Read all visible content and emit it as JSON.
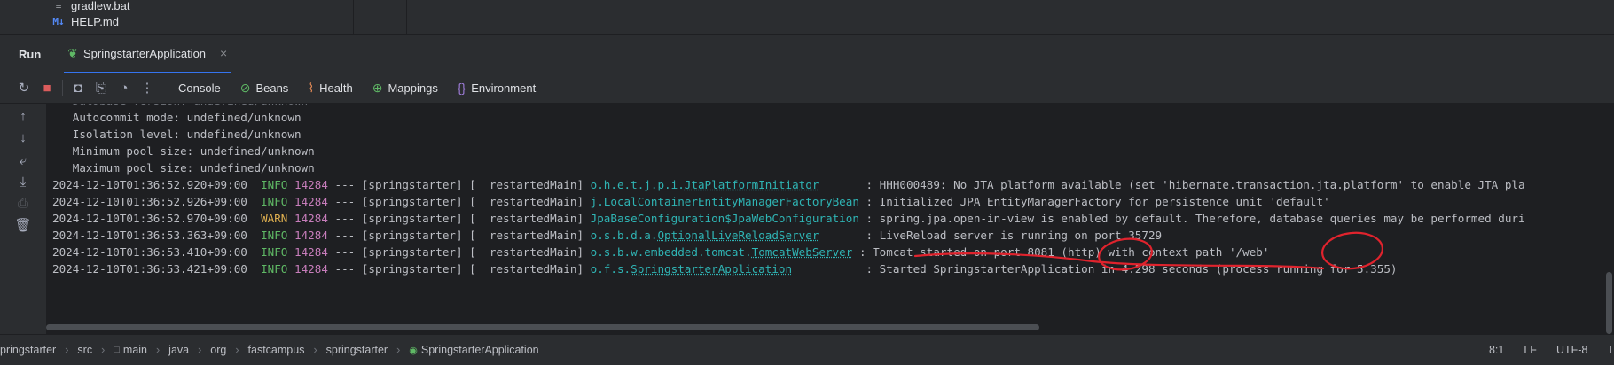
{
  "project_tree": {
    "items": [
      {
        "label": "gradlew.bat",
        "icon": "file-lines-icon"
      },
      {
        "label": "HELP.md",
        "icon": "markdown-icon"
      }
    ]
  },
  "run_window": {
    "title": "Run",
    "tab_label": "SpringstarterApplication"
  },
  "toolbar": {
    "tabs": [
      {
        "label": "Console",
        "icon": ""
      },
      {
        "label": "Beans",
        "icon": "beans-icon"
      },
      {
        "label": "Health",
        "icon": "health-icon"
      },
      {
        "label": "Mappings",
        "icon": "mappings-icon"
      },
      {
        "label": "Environment",
        "icon": "environment-icon"
      }
    ]
  },
  "console": {
    "partial_top": "   Database version: undefined/unknown",
    "plain_lines": [
      "Autocommit mode: undefined/unknown",
      "Isolation level: undefined/unknown",
      "Minimum pool size: undefined/unknown",
      "Maximum pool size: undefined/unknown"
    ],
    "log_lines": [
      {
        "ts": "2024-12-10T01:36:52.920+09:00",
        "level": "INFO",
        "pid": "14284",
        "mid": " --- [springstarter] [  restartedMain] ",
        "logger_prefix": "o.h.e.t.j.p.i.",
        "logger_class": "JtaPlatformInitiator",
        "pad": "       ",
        "message": ": HHH000489: No JTA platform available (set 'hibernate.transaction.jta.platform' to enable JTA pla"
      },
      {
        "ts": "2024-12-10T01:36:52.926+09:00",
        "level": "INFO",
        "pid": "14284",
        "mid": " --- [springstarter] [  restartedMain] ",
        "logger_prefix": "j.LocalContainerEntityManagerFactoryBean",
        "logger_class": "",
        "pad": " ",
        "message": ": Initialized JPA EntityManagerFactory for persistence unit 'default'"
      },
      {
        "ts": "2024-12-10T01:36:52.970+09:00",
        "level": "WARN",
        "pid": "14284",
        "mid": " --- [springstarter] [  restartedMain] ",
        "logger_prefix": "JpaBaseConfiguration$JpaWebConfiguration",
        "logger_class": "",
        "pad": " ",
        "message": ": spring.jpa.open-in-view is enabled by default. Therefore, database queries may be performed duri"
      },
      {
        "ts": "2024-12-10T01:36:53.363+09:00",
        "level": "INFO",
        "pid": "14284",
        "mid": " --- [springstarter] [  restartedMain] ",
        "logger_prefix": "o.s.b.d.a.",
        "logger_class": "OptionalLiveReloadServer",
        "pad": "       ",
        "message": ": LiveReload server is running on port 35729"
      },
      {
        "ts": "2024-12-10T01:36:53.410+09:00",
        "level": "INFO",
        "pid": "14284",
        "mid": " --- [springstarter] [  restartedMain] ",
        "logger_prefix": "o.s.b.w.embedded.tomcat.",
        "logger_class": "TomcatWebServer",
        "pad": " ",
        "message": ": Tomcat started on port 8081 (http) with context path '/web'"
      },
      {
        "ts": "2024-12-10T01:36:53.421+09:00",
        "level": "INFO",
        "pid": "14284",
        "mid": " --- [springstarter] [  restartedMain] ",
        "logger_prefix": "o.f.s.",
        "logger_class": "SpringstarterApplication",
        "pad": "           ",
        "message": ": Started SpringstarterApplication in 4.298 seconds (process running for 5.355)"
      }
    ]
  },
  "statusbar": {
    "breadcrumbs": [
      "pringstarter",
      "src",
      "main",
      "java",
      "org",
      "fastcampus",
      "springstarter",
      "SpringstarterApplication"
    ],
    "position": "8:1",
    "line_sep": "LF",
    "encoding": "UTF-8",
    "extra": "T"
  },
  "colors": {
    "annotation": "#e0232d",
    "accent": "#3574f0"
  }
}
